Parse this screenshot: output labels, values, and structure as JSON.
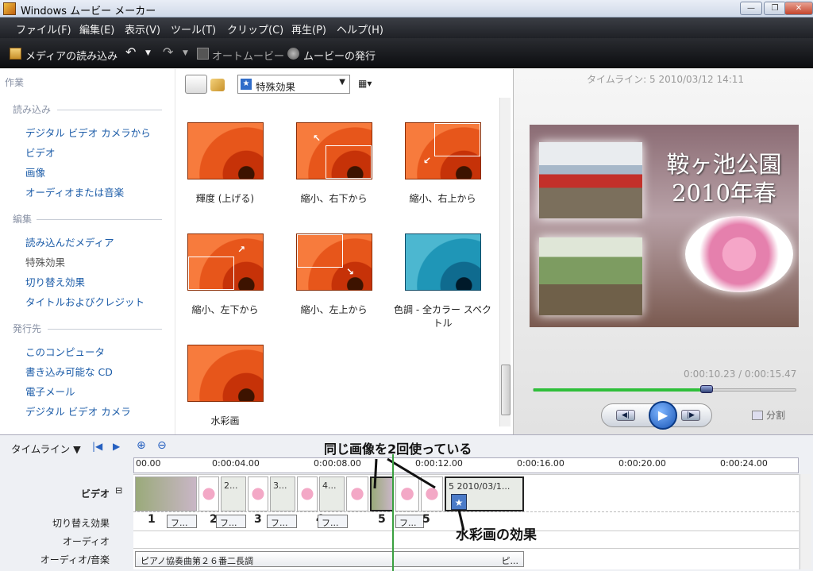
{
  "window": {
    "title": "Windows ムービー メーカー",
    "minimize": "—",
    "maximize": "❐",
    "close": "✕"
  },
  "menu": [
    "ファイル(F)",
    "編集(E)",
    "表示(V)",
    "ツール(T)",
    "クリップ(C)",
    "再生(P)",
    "ヘルプ(H)"
  ],
  "toolbar": {
    "import_media": "メディアの読み込み",
    "auto_movie": "オートムービー",
    "publish": "ムービーの発行"
  },
  "tasks": {
    "heading": "作業",
    "import": {
      "heading": "読み込み",
      "items": [
        "デジタル ビデオ カメラから",
        "ビデオ",
        "画像",
        "オーディオまたは音楽"
      ]
    },
    "edit": {
      "heading": "編集",
      "items": [
        "読み込んだメディア",
        "特殊効果",
        "切り替え効果",
        "タイトルおよびクレジット"
      ]
    },
    "publish": {
      "heading": "発行先",
      "items": [
        "このコンピュータ",
        "書き込み可能な CD",
        "電子メール",
        "デジタル ビデオ カメラ"
      ]
    }
  },
  "collection": {
    "dropdown": "特殊効果",
    "effects": [
      "輝度 (上げる)",
      "縮小、右下から",
      "縮小、右上から",
      "縮小、左下から",
      "縮小、左上から",
      "色調 - 全カラー スペクトル",
      "水彩画"
    ]
  },
  "preview": {
    "title": "タイムライン: 5 2010/03/12 14:11",
    "slide_title_line1": "鞍ヶ池公園",
    "slide_title_line2": "2010年春",
    "time": "0:00:10.23 / 0:00:15.47",
    "progress": 0.66,
    "split_label": "分割"
  },
  "timeline": {
    "label": "タイムライン",
    "ruler": [
      "00.00",
      "0:00:04.00",
      "0:00:08.00",
      "0:00:12.00",
      "0:00:16.00",
      "0:00:20.00",
      "0:00:24.00"
    ],
    "tracks": {
      "video": "ビデオ",
      "transition": "切り替え効果",
      "audio": "オーディオ",
      "music": "オーディオ/音楽"
    },
    "clips": [
      "2...",
      "3...",
      "4...",
      "5 2010/03/1..."
    ],
    "transitions": [
      "フ...",
      "フ...",
      "フ...",
      "フ...",
      "フ..."
    ],
    "numbers": [
      "1",
      "2",
      "3",
      "4",
      "5",
      "5"
    ],
    "music_clip": "ピアノ協奏曲第２６番二長調",
    "music_end": "ピ..."
  },
  "annotations": {
    "same_image": "同じ画像を2回使っている",
    "watercolor": "水彩画の効果"
  },
  "colors": {
    "menu_bg": "#1f2126",
    "link": "#1c5ca8",
    "seek": "#2fbf3a",
    "playhead": "#3aa040"
  }
}
